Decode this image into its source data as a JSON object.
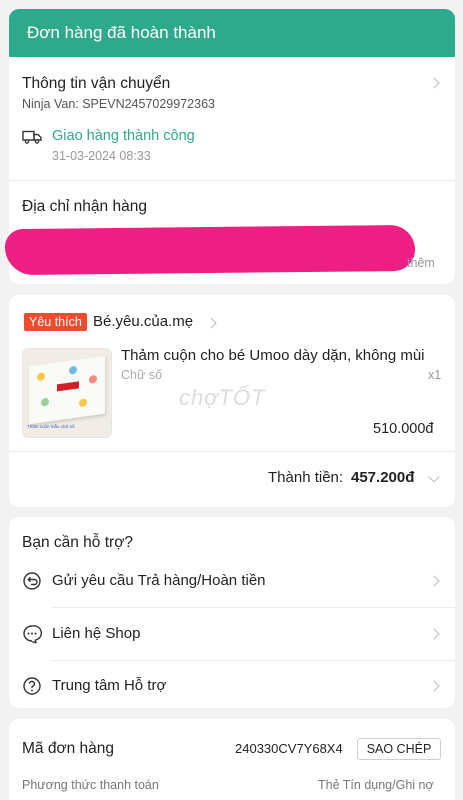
{
  "header": {
    "title": "Đơn hàng đã hoàn thành",
    "color": "#2fa98c"
  },
  "shipping": {
    "title": "Thông tin vận chuyển",
    "carrier": "Ninja Van: SPEVN2457029972363",
    "status": "Giao hàng thành công",
    "time": "31-03-2024 08:33",
    "icon": "truck-icon"
  },
  "address": {
    "title": "Địa chỉ nhận hàng",
    "more": "thêm"
  },
  "shop": {
    "badge": "Yêu thích",
    "name": "Bé.yêu.của.mẹ"
  },
  "product": {
    "name": "Thảm cuộn cho bé Umoo dày dặn, không mùi",
    "variant": "Chữ số",
    "qty": "x1",
    "price": "510.000đ",
    "thumb_caption": "Thảm cuộn mẫu chữ số",
    "watermark": "chợTỐT"
  },
  "total": {
    "label": "Thành tiền:",
    "value": "457.200đ"
  },
  "help": {
    "title": "Bạn cần hỗ trợ?",
    "items": [
      {
        "label": "Gửi yêu cầu Trả hàng/Hoàn tiền",
        "icon": "return-icon"
      },
      {
        "label": "Liên hệ Shop",
        "icon": "chat-icon"
      },
      {
        "label": "Trung tâm Hỗ trợ",
        "icon": "help-icon"
      }
    ]
  },
  "order": {
    "label": "Mã đơn hàng",
    "code": "240330CV7Y68X4",
    "copy": "SAO CHÉP",
    "payment_label": "Phương thức thanh toán",
    "payment_value": "Thẻ Tín dụng/Ghi nợ"
  }
}
